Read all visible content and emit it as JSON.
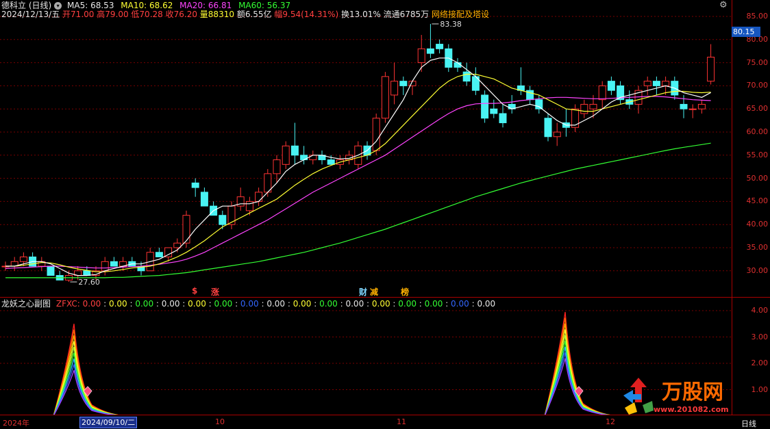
{
  "header": {
    "stock_name": "德科立 (日线)",
    "ma5_label": "MA5:",
    "ma5_value": "68.53",
    "ma10_label": "MA10:",
    "ma10_value": "68.62",
    "ma20_label": "MA20:",
    "ma20_value": "66.81",
    "ma60_label": "MA60:",
    "ma60_value": "56.37"
  },
  "quote": {
    "date": "2024/12/13/五",
    "open": "开71.00",
    "high": "高79.00",
    "low": "低70.28",
    "close": "收76.20",
    "volume": "量88310",
    "amount": "额6.55亿",
    "change": "幅9.54(14.31%)",
    "turnover": "换13.01%",
    "float": "流通6785万",
    "concept": "网络接配及塔设"
  },
  "price_axis": [
    "85.00",
    "80.00",
    "75.00",
    "70.00",
    "65.00",
    "60.00",
    "55.00",
    "50.00",
    "45.00",
    "40.00",
    "35.00",
    "30.00"
  ],
  "price_tag": "80.15",
  "annotations": {
    "high_label": "83.38",
    "low_label": "27.60"
  },
  "markers": [
    "$",
    "涨",
    "财",
    "减",
    "榜"
  ],
  "sub_panel": {
    "title": "龙妖之心副图",
    "indicator": "ZFXC:",
    "values": [
      "0.00",
      "0.00",
      "0.00",
      "0.00",
      "0.00",
      "0.00",
      "0.00",
      "0.00",
      "0.00",
      "0.00",
      "0.00",
      "0.00",
      "0.00",
      "0.00",
      "0.00",
      "0.00",
      "0.00"
    ],
    "axis": [
      "4.00",
      "3.00",
      "2.00",
      "1.00",
      "0.00"
    ]
  },
  "date_axis": {
    "year": "2024年",
    "selected": "2024/09/10/二",
    "m10": "10",
    "m11": "11",
    "m12": "12",
    "period": "日线"
  },
  "watermark": {
    "brand": "万股网",
    "url": "www.201082.com"
  },
  "colors": {
    "up": "#ff3333",
    "down": "#49f3f3",
    "ma5": "#ffffff",
    "ma10": "#ffff33",
    "ma20": "#ff44ff",
    "ma60": "#33ff33"
  },
  "chart_data": {
    "type": "candlestick",
    "ylim": [
      26,
      86
    ],
    "candles": [
      [
        31,
        32,
        30,
        31
      ],
      [
        31,
        33,
        30,
        32
      ],
      [
        32,
        34,
        31,
        33
      ],
      [
        33,
        34,
        31,
        31
      ],
      [
        31,
        33,
        30,
        32
      ],
      [
        31,
        31,
        29,
        29
      ],
      [
        29,
        30,
        28,
        28
      ],
      [
        28,
        30,
        27.6,
        29
      ],
      [
        29,
        31,
        28,
        30
      ],
      [
        30,
        31,
        29,
        29
      ],
      [
        29,
        31,
        28,
        30
      ],
      [
        30,
        33,
        29,
        32
      ],
      [
        32,
        33,
        31,
        31
      ],
      [
        31,
        33,
        30,
        32
      ],
      [
        32,
        33,
        31,
        31
      ],
      [
        31,
        32,
        29,
        30
      ],
      [
        30,
        35,
        30,
        34
      ],
      [
        34,
        35,
        33,
        33
      ],
      [
        33,
        35,
        32,
        35
      ],
      [
        35,
        37,
        34,
        36
      ],
      [
        36,
        43,
        35,
        42
      ],
      [
        49,
        50,
        46,
        48
      ],
      [
        47,
        48,
        44,
        44
      ],
      [
        44,
        45,
        42,
        42
      ],
      [
        42,
        43,
        39,
        40
      ],
      [
        40,
        45,
        39,
        44
      ],
      [
        44,
        48,
        43,
        46
      ],
      [
        43,
        46,
        42,
        45
      ],
      [
        45,
        48,
        44,
        47
      ],
      [
        47,
        52,
        46,
        51
      ],
      [
        51,
        55,
        49,
        54
      ],
      [
        53,
        58,
        52,
        57
      ],
      [
        57,
        62,
        53,
        55
      ],
      [
        55,
        57,
        53,
        54
      ],
      [
        54,
        56,
        53,
        55
      ],
      [
        55,
        56,
        53,
        54
      ],
      [
        54,
        55,
        53,
        53
      ],
      [
        53,
        55,
        52,
        54
      ],
      [
        54,
        56,
        53,
        55
      ],
      [
        53,
        58,
        52,
        57
      ],
      [
        57,
        58,
        54,
        55
      ],
      [
        56,
        64,
        55,
        63
      ],
      [
        63,
        73,
        62,
        72
      ],
      [
        68,
        75,
        66,
        71
      ],
      [
        71,
        72,
        68,
        70
      ],
      [
        70,
        71,
        68,
        71
      ],
      [
        75,
        81,
        73,
        78
      ],
      [
        78,
        83.38,
        76,
        77
      ],
      [
        79,
        80,
        77,
        78
      ],
      [
        78,
        79,
        73,
        74
      ],
      [
        75,
        76,
        73,
        74
      ],
      [
        73,
        75,
        70,
        71
      ],
      [
        72,
        74,
        68,
        69
      ],
      [
        68,
        69,
        62,
        63
      ],
      [
        65,
        67,
        63,
        64
      ],
      [
        64,
        66,
        61,
        62
      ],
      [
        66,
        68,
        64,
        65
      ],
      [
        70,
        74,
        68,
        69
      ],
      [
        69,
        70,
        66,
        67
      ],
      [
        67,
        68,
        64,
        65
      ],
      [
        63,
        64,
        58,
        59
      ],
      [
        59,
        62,
        57,
        60
      ],
      [
        62,
        65,
        59,
        61
      ],
      [
        61,
        66,
        60,
        65
      ],
      [
        64,
        67,
        63,
        66
      ],
      [
        65,
        68,
        63,
        66
      ],
      [
        67,
        71,
        65,
        70
      ],
      [
        71,
        72,
        68,
        69
      ],
      [
        70,
        71,
        66,
        67
      ],
      [
        67,
        69,
        65,
        66
      ],
      [
        66,
        70,
        64,
        69
      ],
      [
        70,
        72,
        68,
        71
      ],
      [
        71,
        72,
        68,
        70
      ],
      [
        70,
        72,
        68,
        71
      ],
      [
        71,
        72,
        67,
        68
      ],
      [
        66,
        68,
        63,
        65
      ],
      [
        65,
        66,
        63,
        65
      ],
      [
        65,
        67,
        64,
        66
      ],
      [
        71,
        79,
        70.28,
        76.2
      ]
    ],
    "ma5": [
      31,
      31,
      31.5,
      32,
      32,
      31.5,
      30.5,
      29.5,
      29,
      29,
      29.2,
      30,
      30.5,
      31,
      31.5,
      31.5,
      32,
      32.5,
      33.5,
      34.5,
      36.5,
      39,
      41,
      43,
      44,
      44,
      44.5,
      44.5,
      45,
      47,
      49,
      51.5,
      53,
      54,
      55,
      55,
      54.5,
      54.2,
      54.3,
      55,
      56,
      58,
      61,
      64,
      67,
      71,
      74,
      75.5,
      76,
      76,
      75,
      73.5,
      72,
      70,
      68,
      66,
      65,
      65.5,
      66,
      65.5,
      64,
      62.5,
      61.5,
      61.5,
      62.5,
      63.5,
      65,
      66.5,
      67.5,
      68,
      68.5,
      69,
      69.5,
      70,
      69.5,
      68.5,
      68,
      67.5,
      68.53
    ],
    "ma10": [
      31,
      31,
      31.2,
      31.5,
      31.8,
      31.7,
      31.3,
      30.8,
      30.4,
      30.1,
      29.8,
      29.8,
      30,
      30.3,
      30.6,
      30.8,
      31,
      31.5,
      32.2,
      33,
      34,
      35.2,
      36.5,
      38,
      39.5,
      40.5,
      41.5,
      42.5,
      43.5,
      44.5,
      45.5,
      47,
      48.5,
      49.8,
      51,
      52,
      52.8,
      53.5,
      54,
      54.5,
      55,
      56,
      57.5,
      59.5,
      61.5,
      63.5,
      65.5,
      67.5,
      69.5,
      71,
      72,
      72.5,
      72.5,
      72,
      71.5,
      70.5,
      69.5,
      69,
      68.5,
      68,
      67,
      66,
      65,
      64.8,
      64.5,
      64.5,
      65,
      65.5,
      66,
      66.5,
      67,
      67.5,
      68,
      68.5,
      68.8,
      68.8,
      68.6,
      68.5,
      68.62
    ],
    "ma20": [
      30.5,
      30.6,
      30.7,
      30.8,
      30.9,
      31,
      31,
      30.9,
      30.8,
      30.7,
      30.6,
      30.6,
      30.7,
      30.8,
      30.9,
      31,
      31.2,
      31.4,
      31.7,
      32,
      32.5,
      33.2,
      34,
      35,
      36,
      37,
      38,
      39,
      40,
      41,
      42.2,
      43.4,
      44.6,
      45.8,
      47,
      48,
      49,
      50,
      51,
      52,
      53,
      54,
      55,
      56.3,
      57.6,
      58.9,
      60.2,
      61.5,
      62.8,
      64,
      65,
      65.7,
      66.1,
      66.2,
      66.2,
      66.3,
      66.5,
      66.8,
      67,
      67.2,
      67.4,
      67.5,
      67.5,
      67.4,
      67.3,
      67.2,
      67.2,
      67.3,
      67.4,
      67.5,
      67.6,
      67.7,
      67.7,
      67.6,
      67.4,
      67.2,
      67,
      66.9,
      66.81
    ],
    "ma60": [
      28.5,
      28.5,
      28.5,
      28.5,
      28.5,
      28.5,
      28.5,
      28.5,
      28.5,
      28.5,
      28.5,
      28.5,
      28.6,
      28.6,
      28.7,
      28.8,
      28.9,
      29,
      29.2,
      29.4,
      29.6,
      29.9,
      30.2,
      30.5,
      30.8,
      31.1,
      31.4,
      31.7,
      32,
      32.4,
      32.8,
      33.2,
      33.6,
      34,
      34.5,
      35,
      35.5,
      36,
      36.6,
      37.2,
      37.8,
      38.4,
      39,
      39.7,
      40.4,
      41.1,
      41.8,
      42.5,
      43.2,
      43.9,
      44.6,
      45.3,
      46,
      46.6,
      47.2,
      47.8,
      48.4,
      49,
      49.5,
      50,
      50.5,
      51,
      51.5,
      52,
      52.4,
      52.8,
      53.2,
      53.6,
      54,
      54.4,
      54.8,
      55.2,
      55.6,
      56,
      56.37,
      56.7,
      57,
      57.3,
      57.6
    ]
  }
}
